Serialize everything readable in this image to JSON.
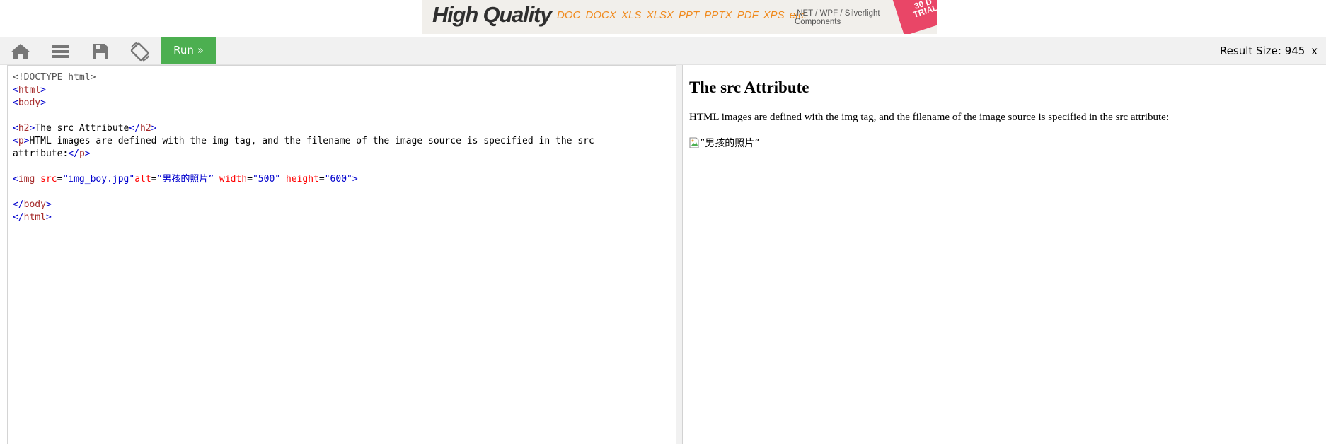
{
  "ad": {
    "headline": "High Quality",
    "formats": "DOC DOCX XLS XLSX PPT PPTX PDF XPS etc.",
    "components_line1": ".NET / WPF / Silverlight",
    "components_line2": "Components",
    "trial_line1": "30 D",
    "trial_line2": "TRIAL",
    "trial_color": "#e94667",
    "formats_color": "#f08a1d"
  },
  "toolbar": {
    "icons": [
      "home-icon",
      "menu-icon",
      "save-icon",
      "rotate-icon"
    ],
    "run_label": "Run »",
    "run_color": "#4caf50",
    "result_size_label": "Result Size:",
    "result_size_value": "945",
    "result_close": "x"
  },
  "editor": {
    "colors": {
      "tag": "#a52a2a",
      "attr": "#ff0000",
      "value": "#0000cd",
      "doctype": "#555555"
    },
    "doctype": "<!DOCTYPE html>",
    "tag_html": "html",
    "tag_body": "body",
    "tag_h2": "h2",
    "h2_text": "The src Attribute",
    "tag_p": "p",
    "p_text_line1": "HTML images are defined with the img tag, and the filename of the image source is specified in the src",
    "p_text_line2": "attribute:",
    "tag_img": "img",
    "attr_src": "src",
    "val_src": "\"img_boy.jpg\"",
    "attr_alt": "alt",
    "val_alt": "”男孩的照片”",
    "attr_width": "width",
    "val_width": "\"500\"",
    "attr_height": "height",
    "val_height": "\"600\""
  },
  "result": {
    "heading": "The src Attribute",
    "paragraph": "HTML images are defined with the img tag, and the filename of the image source is specified in the src attribute:",
    "img_alt": "”男孩的照片”"
  }
}
